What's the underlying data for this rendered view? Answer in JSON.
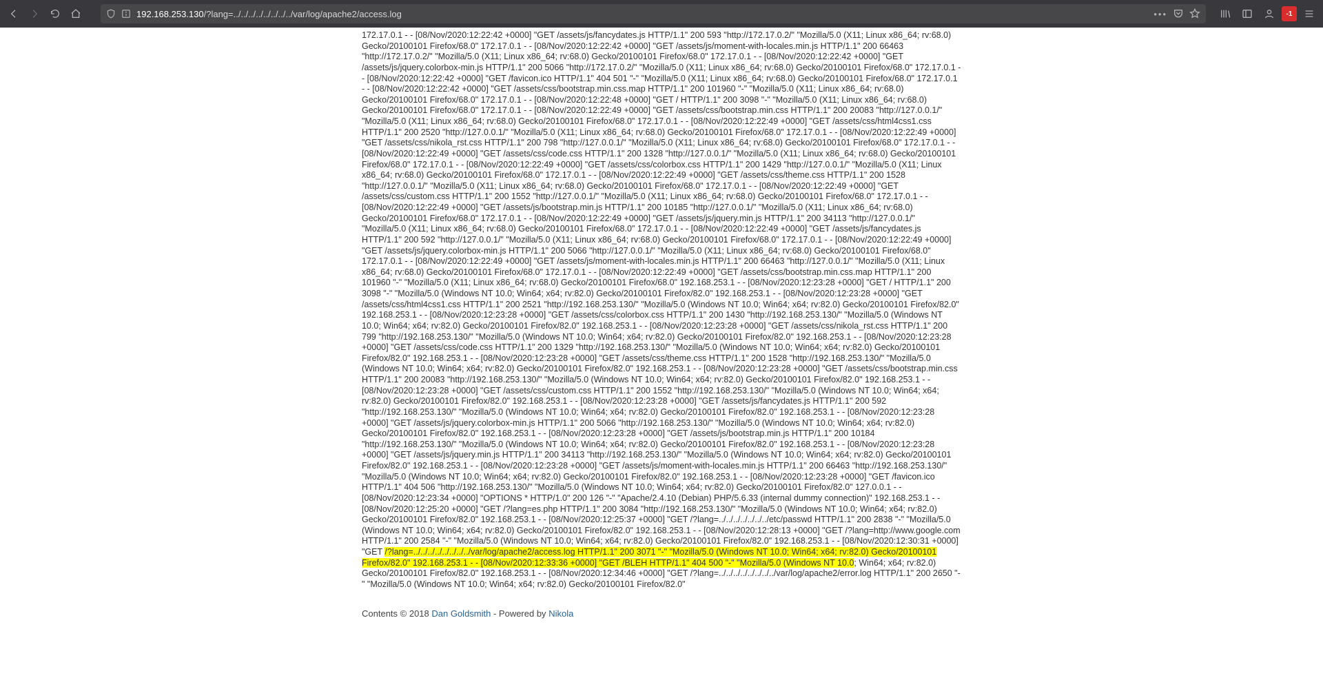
{
  "nav": {
    "back": "Back",
    "forward": "Forward",
    "reload": "Reload",
    "home": "Home"
  },
  "urlbar": {
    "shield_title": "Tracking protection",
    "favicon_title": "Site information",
    "host": "192.168.253.130",
    "path": "/?lang=../../../../../../../../var/log/apache2/access.log",
    "tail_dots": "•••",
    "pocket_title": "Save to Pocket",
    "bookmark_title": "Bookmark this page"
  },
  "right": {
    "library": "Library",
    "sidebar": "Sidebars",
    "fxa": "Firefox Account",
    "ext_label": "-1",
    "menu": "Menu"
  },
  "log": {
    "pre": "172.17.0.1 - - [08/Nov/2020:12:22:42 +0000] \"GET /assets/js/fancydates.js HTTP/1.1\" 200 593 \"http://172.17.0.2/\" \"Mozilla/5.0 (X11; Linux x86_64; rv:68.0) Gecko/20100101 Firefox/68.0\" 172.17.0.1 - - [08/Nov/2020:12:22:42 +0000] \"GET /assets/js/moment-with-locales.min.js HTTP/1.1\" 200 66463 \"http://172.17.0.2/\" \"Mozilla/5.0 (X11; Linux x86_64; rv:68.0) Gecko/20100101 Firefox/68.0\" 172.17.0.1 - - [08/Nov/2020:12:22:42 +0000] \"GET /assets/js/jquery.colorbox-min.js HTTP/1.1\" 200 5066 \"http://172.17.0.2/\" \"Mozilla/5.0 (X11; Linux x86_64; rv:68.0) Gecko/20100101 Firefox/68.0\" 172.17.0.1 - - [08/Nov/2020:12:22:42 +0000] \"GET /favicon.ico HTTP/1.1\" 404 501 \"-\" \"Mozilla/5.0 (X11; Linux x86_64; rv:68.0) Gecko/20100101 Firefox/68.0\" 172.17.0.1 - - [08/Nov/2020:12:22:42 +0000] \"GET /assets/css/bootstrap.min.css.map HTTP/1.1\" 200 101960 \"-\" \"Mozilla/5.0 (X11; Linux x86_64; rv:68.0) Gecko/20100101 Firefox/68.0\" 172.17.0.1 - - [08/Nov/2020:12:22:48 +0000] \"GET / HTTP/1.1\" 200 3098 \"-\" \"Mozilla/5.0 (X11; Linux x86_64; rv:68.0) Gecko/20100101 Firefox/68.0\" 172.17.0.1 - - [08/Nov/2020:12:22:49 +0000] \"GET /assets/css/bootstrap.min.css HTTP/1.1\" 200 20083 \"http://127.0.0.1/\" \"Mozilla/5.0 (X11; Linux x86_64; rv:68.0) Gecko/20100101 Firefox/68.0\" 172.17.0.1 - - [08/Nov/2020:12:22:49 +0000] \"GET /assets/css/html4css1.css HTTP/1.1\" 200 2520 \"http://127.0.0.1/\" \"Mozilla/5.0 (X11; Linux x86_64; rv:68.0) Gecko/20100101 Firefox/68.0\" 172.17.0.1 - - [08/Nov/2020:12:22:49 +0000] \"GET /assets/css/nikola_rst.css HTTP/1.1\" 200 798 \"http://127.0.0.1/\" \"Mozilla/5.0 (X11; Linux x86_64; rv:68.0) Gecko/20100101 Firefox/68.0\" 172.17.0.1 - - [08/Nov/2020:12:22:49 +0000] \"GET /assets/css/code.css HTTP/1.1\" 200 1328 \"http://127.0.0.1/\" \"Mozilla/5.0 (X11; Linux x86_64; rv:68.0) Gecko/20100101 Firefox/68.0\" 172.17.0.1 - - [08/Nov/2020:12:22:49 +0000] \"GET /assets/css/colorbox.css HTTP/1.1\" 200 1429 \"http://127.0.0.1/\" \"Mozilla/5.0 (X11; Linux x86_64; rv:68.0) Gecko/20100101 Firefox/68.0\" 172.17.0.1 - - [08/Nov/2020:12:22:49 +0000] \"GET /assets/css/theme.css HTTP/1.1\" 200 1528 \"http://127.0.0.1/\" \"Mozilla/5.0 (X11; Linux x86_64; rv:68.0) Gecko/20100101 Firefox/68.0\" 172.17.0.1 - - [08/Nov/2020:12:22:49 +0000] \"GET /assets/css/custom.css HTTP/1.1\" 200 1552 \"http://127.0.0.1/\" \"Mozilla/5.0 (X11; Linux x86_64; rv:68.0) Gecko/20100101 Firefox/68.0\" 172.17.0.1 - - [08/Nov/2020:12:22:49 +0000] \"GET /assets/js/bootstrap.min.js HTTP/1.1\" 200 10185 \"http://127.0.0.1/\" \"Mozilla/5.0 (X11; Linux x86_64; rv:68.0) Gecko/20100101 Firefox/68.0\" 172.17.0.1 - - [08/Nov/2020:12:22:49 +0000] \"GET /assets/js/jquery.min.js HTTP/1.1\" 200 34113 \"http://127.0.0.1/\" \"Mozilla/5.0 (X11; Linux x86_64; rv:68.0) Gecko/20100101 Firefox/68.0\" 172.17.0.1 - - [08/Nov/2020:12:22:49 +0000] \"GET /assets/js/fancydates.js HTTP/1.1\" 200 592 \"http://127.0.0.1/\" \"Mozilla/5.0 (X11; Linux x86_64; rv:68.0) Gecko/20100101 Firefox/68.0\" 172.17.0.1 - - [08/Nov/2020:12:22:49 +0000] \"GET /assets/js/jquery.colorbox-min.js HTTP/1.1\" 200 5066 \"http://127.0.0.1/\" \"Mozilla/5.0 (X11; Linux x86_64; rv:68.0) Gecko/20100101 Firefox/68.0\" 172.17.0.1 - - [08/Nov/2020:12:22:49 +0000] \"GET /assets/js/moment-with-locales.min.js HTTP/1.1\" 200 66463 \"http://127.0.0.1/\" \"Mozilla/5.0 (X11; Linux x86_64; rv:68.0) Gecko/20100101 Firefox/68.0\" 172.17.0.1 - - [08/Nov/2020:12:22:49 +0000] \"GET /assets/css/bootstrap.min.css.map HTTP/1.1\" 200 101960 \"-\" \"Mozilla/5.0 (X11; Linux x86_64; rv:68.0) Gecko/20100101 Firefox/68.0\" 192.168.253.1 - - [08/Nov/2020:12:23:28 +0000] \"GET / HTTP/1.1\" 200 3098 \"-\" \"Mozilla/5.0 (Windows NT 10.0; Win64; x64; rv:82.0) Gecko/20100101 Firefox/82.0\" 192.168.253.1 - - [08/Nov/2020:12:23:28 +0000] \"GET /assets/css/html4css1.css HTTP/1.1\" 200 2521 \"http://192.168.253.130/\" \"Mozilla/5.0 (Windows NT 10.0; Win64; x64; rv:82.0) Gecko/20100101 Firefox/82.0\" 192.168.253.1 - - [08/Nov/2020:12:23:28 +0000] \"GET /assets/css/colorbox.css HTTP/1.1\" 200 1430 \"http://192.168.253.130/\" \"Mozilla/5.0 (Windows NT 10.0; Win64; x64; rv:82.0) Gecko/20100101 Firefox/82.0\" 192.168.253.1 - - [08/Nov/2020:12:23:28 +0000] \"GET /assets/css/nikola_rst.css HTTP/1.1\" 200 799 \"http://192.168.253.130/\" \"Mozilla/5.0 (Windows NT 10.0; Win64; x64; rv:82.0) Gecko/20100101 Firefox/82.0\" 192.168.253.1 - - [08/Nov/2020:12:23:28 +0000] \"GET /assets/css/code.css HTTP/1.1\" 200 1329 \"http://192.168.253.130/\" \"Mozilla/5.0 (Windows NT 10.0; Win64; x64; rv:82.0) Gecko/20100101 Firefox/82.0\" 192.168.253.1 - - [08/Nov/2020:12:23:28 +0000] \"GET /assets/css/theme.css HTTP/1.1\" 200 1528 \"http://192.168.253.130/\" \"Mozilla/5.0 (Windows NT 10.0; Win64; x64; rv:82.0) Gecko/20100101 Firefox/82.0\" 192.168.253.1 - - [08/Nov/2020:12:23:28 +0000] \"GET /assets/css/bootstrap.min.css HTTP/1.1\" 200 20083 \"http://192.168.253.130/\" \"Mozilla/5.0 (Windows NT 10.0; Win64; x64; rv:82.0) Gecko/20100101 Firefox/82.0\" 192.168.253.1 - - [08/Nov/2020:12:23:28 +0000] \"GET /assets/css/custom.css HTTP/1.1\" 200 1552 \"http://192.168.253.130/\" \"Mozilla/5.0 (Windows NT 10.0; Win64; x64; rv:82.0) Gecko/20100101 Firefox/82.0\" 192.168.253.1 - - [08/Nov/2020:12:23:28 +0000] \"GET /assets/js/fancydates.js HTTP/1.1\" 200 592 \"http://192.168.253.130/\" \"Mozilla/5.0 (Windows NT 10.0; Win64; x64; rv:82.0) Gecko/20100101 Firefox/82.0\" 192.168.253.1 - - [08/Nov/2020:12:23:28 +0000] \"GET /assets/js/jquery.colorbox-min.js HTTP/1.1\" 200 5066 \"http://192.168.253.130/\" \"Mozilla/5.0 (Windows NT 10.0; Win64; x64; rv:82.0) Gecko/20100101 Firefox/82.0\" 192.168.253.1 - - [08/Nov/2020:12:23:28 +0000] \"GET /assets/js/bootstrap.min.js HTTP/1.1\" 200 10184 \"http://192.168.253.130/\" \"Mozilla/5.0 (Windows NT 10.0; Win64; x64; rv:82.0) Gecko/20100101 Firefox/82.0\" 192.168.253.1 - - [08/Nov/2020:12:23:28 +0000] \"GET /assets/js/jquery.min.js HTTP/1.1\" 200 34113 \"http://192.168.253.130/\" \"Mozilla/5.0 (Windows NT 10.0; Win64; x64; rv:82.0) Gecko/20100101 Firefox/82.0\" 192.168.253.1 - - [08/Nov/2020:12:23:28 +0000] \"GET /assets/js/moment-with-locales.min.js HTTP/1.1\" 200 66463 \"http://192.168.253.130/\" \"Mozilla/5.0 (Windows NT 10.0; Win64; x64; rv:82.0) Gecko/20100101 Firefox/82.0\" 192.168.253.1 - - [08/Nov/2020:12:23:28 +0000] \"GET /favicon.ico HTTP/1.1\" 404 506 \"http://192.168.253.130/\" \"Mozilla/5.0 (Windows NT 10.0; Win64; x64; rv:82.0) Gecko/20100101 Firefox/82.0\" 127.0.0.1 - - [08/Nov/2020:12:23:34 +0000] \"OPTIONS * HTTP/1.0\" 200 126 \"-\" \"Apache/2.4.10 (Debian) PHP/5.6.33 (internal dummy connection)\" 192.168.253.1 - - [08/Nov/2020:12:25:20 +0000] \"GET /?lang=es.php HTTP/1.1\" 200 3084 \"http://192.168.253.130/\" \"Mozilla/5.0 (Windows NT 10.0; Win64; x64; rv:82.0) Gecko/20100101 Firefox/82.0\" 192.168.253.1 - - [08/Nov/2020:12:25:37 +0000] \"GET /?lang=../../../../../../../etc/passwd HTTP/1.1\" 200 2838 \"-\" \"Mozilla/5.0 (Windows NT 10.0; Win64; x64; rv:82.0) Gecko/20100101 Firefox/82.0\" 192.168.253.1 - - [08/Nov/2020:12:28:13 +0000] \"GET /?lang=http://www.google.com HTTP/1.1\" 200 2584 \"-\" \"Mozilla/5.0 (Windows NT 10.0; Win64; x64; rv:82.0) Gecko/20100101 Firefox/82.0\" 192.168.253.1 - - [08/Nov/2020:12:30:31 +0000] \"GET ",
    "hl1": "/?lang=../../../../../../../../var/log/apache2/access.log HTTP/1.1\" 200 3071 \"-\" \"Mozilla/5.0 (Windows NT 10.0; Win64; x64; rv:82.0) Gecko/20100101 Firefox/82.0\" 192.168.253.1 - - [08/Nov/2020:12:33:36 +0000] \"GET /BLEH HTTP/1.1\" 404 500 \"-\" \"Mozilla/5.0 (Windows NT 10.0",
    "post": "; Win64; x64; rv:82.0) Gecko/20100101 Firefox/82.0\" 192.168.253.1 - - [08/Nov/2020:12:34:46 +0000] \"GET /?lang=../../../../../../../../var/log/apache2/error.log HTTP/1.1\" 200 2650 \"-\" \"Mozilla/5.0 (Windows NT 10.0; Win64; x64; rv:82.0) Gecko/20100101 Firefox/82.0\""
  },
  "footer": {
    "contents": "Contents © 2018 ",
    "author": "Dan Goldsmith",
    "powered": " - Powered by ",
    "engine": "Nikola"
  }
}
